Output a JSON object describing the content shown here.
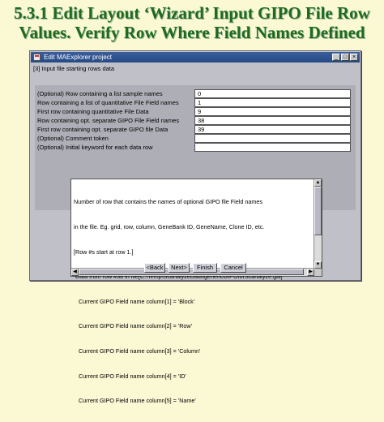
{
  "slide": {
    "title_line1": "5.3.1 Edit Layout ‘Wizard’ Input GIPO File Row",
    "title_line2": "Values. Verify Row Where Field Names Defined"
  },
  "window": {
    "title": "Edit MAExplorer project",
    "controls": {
      "minimize": "_",
      "maximize": "□",
      "close": "×"
    },
    "section_label": "[3] Input file starting rows data"
  },
  "form": {
    "rows": [
      {
        "label": "(Optional) Row containing a list sample names",
        "value": "0"
      },
      {
        "label": "Row containing a list of quantitative File Field names",
        "value": "1"
      },
      {
        "label": "First row containing quantitative File Data",
        "value": "9"
      },
      {
        "label": "Row containing opt. separate GIPO File Field names",
        "value": "38"
      },
      {
        "label": "First row containing opt. separate GIPO file Data",
        "value": "39"
      },
      {
        "label": "(Optional) Comment token",
        "value": ""
      },
      {
        "label": "(Optional) Initial keyword for each data row",
        "value": ""
      }
    ]
  },
  "info_text": {
    "lines": [
      "Number of row that contains the names of optional GIPO file Field names",
      "in the file. Eg. grid, row, column, GeneBank ID, GeneName, Clone ID, etc.",
      "[Row #s start at row 1.]",
      " Data from row #38 in file[C:\\Temp\\ScanalyzeData\\genericGIPOforScanalyze.gal]",
      "   Current GIPO Field name column[1] = 'Block'",
      "   Current GIPO Field name column[2] = 'Row'",
      "   Current GIPO Field name column[3] = 'Column'",
      "   Current GIPO Field name column[4] = 'ID'",
      "   Current GIPO Field name column[5] = 'Name'"
    ]
  },
  "buttons": {
    "back": "<Back",
    "next": "Next>",
    "finish": "Finish",
    "cancel": "Cancel"
  }
}
